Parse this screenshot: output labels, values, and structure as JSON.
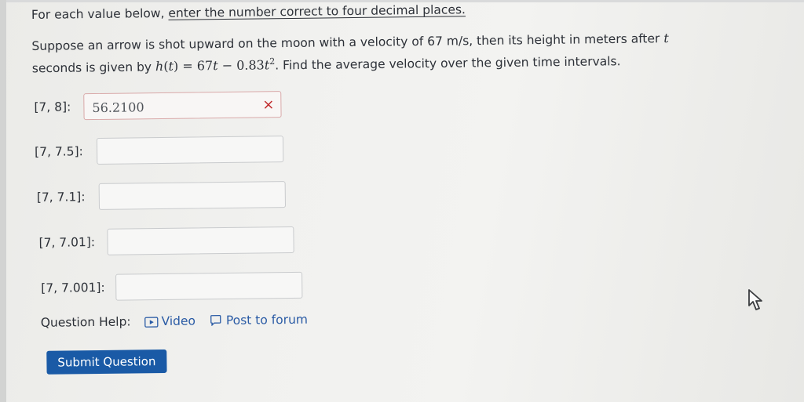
{
  "instruction": {
    "prefix": "For each value below, ",
    "underlined": "enter the number correct to four decimal places."
  },
  "problem": {
    "line1": "Suppose an arrow is shot upward on the moon with a velocity of 67 m/s, then its height in meters after",
    "line1_var": "t",
    "line2_prefix": "seconds is given by",
    "fn_name": "h",
    "fn_arg": "t",
    "equals": "=",
    "term1": "67",
    "term1_var": "t",
    "minus": "−",
    "coef2": "0.83",
    "term2_var": "t",
    "exponent": "2",
    "line2_suffix": ". Find the average velocity over the given time intervals."
  },
  "rows": [
    {
      "label": "[7, 8]:",
      "value": "56.2100",
      "status": "incorrect",
      "status_icon": "×"
    },
    {
      "label": "[7, 7.5]:",
      "value": ""
    },
    {
      "label": "[7, 7.1]:",
      "value": ""
    },
    {
      "label": "[7, 7.01]:",
      "value": ""
    },
    {
      "label": "[7, 7.001]:",
      "value": ""
    }
  ],
  "help": {
    "label": "Question Help:",
    "video": "Video",
    "forum": "Post to forum"
  },
  "submit_label": "Submit Question",
  "colors": {
    "accent": "#1a5aa6",
    "link": "#2a5ba5",
    "error": "#c0292b"
  }
}
